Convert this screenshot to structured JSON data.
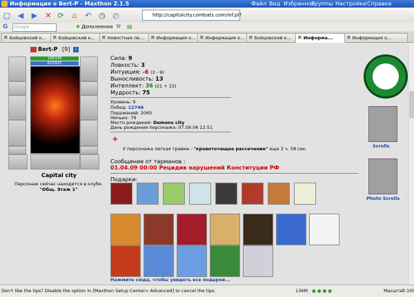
{
  "window": {
    "title": "Информация о Bert-P - Maxthon 2.1.5",
    "menu": [
      "Файл",
      "Вид",
      "Избранное",
      "Группы",
      "Настройки",
      "Справка"
    ]
  },
  "toolbar": {
    "address": "http://capitalcity.combats.com/inf.pl?login=Bert-P",
    "search_placeholder": "Google",
    "addons_label": "Дополнения"
  },
  "tabs": [
    {
      "label": "Бойцовский к..."
    },
    {
      "label": "Бойцовский к..."
    },
    {
      "label": "Новостная ле..."
    },
    {
      "label": "Информация о..."
    },
    {
      "label": "Информация о..."
    },
    {
      "label": "Бойцовский к..."
    },
    {
      "label": "Информа..."
    },
    {
      "label": "Информация о..."
    }
  ],
  "character": {
    "nick": "Bert-P",
    "level_badge": "[9]",
    "hp": "198/198",
    "mp": "625/625",
    "city": "Capital city",
    "location_text": "Персонаж сейчас находится в клубе.",
    "floor": "\"Общ. Этаж 1\""
  },
  "stats": {
    "strength_label": "Сила:",
    "strength": "9",
    "agility_label": "Ловкость:",
    "agility": "3",
    "intuition_label": "Интуиция:",
    "intuition": "-6",
    "intuition_extra": "(3 - 9)",
    "endurance_label": "Выносливость:",
    "endurance": "13",
    "intellect_label": "Интеллект:",
    "intellect": "36",
    "intellect_extra": "(21 + 15)",
    "wisdom_label": "Мудрость:",
    "wisdom": "75"
  },
  "info": {
    "level_label": "Уровень:",
    "level": "9",
    "wins_label": "Побед:",
    "wins": "12746",
    "losses_label": "Поражений:",
    "losses": "2065",
    "draws_label": "Ничьих:",
    "draws": "79",
    "birthplace_label": "Место рождения:",
    "birthplace": "Demons city",
    "birthday_label": "День рождения персонажа:",
    "birthday": "07.09.06 12:51"
  },
  "trauma": {
    "prefix": "У персонажа легкая травма -",
    "name": "\"кровоточащее рассечение\"",
    "suffix": "еще 3 ч. 58 сек."
  },
  "message": {
    "header": "Сообщение от тарманов :",
    "text": "01.04.09 00:00 Рецидив нарушений Конституции РФ"
  },
  "gifts": {
    "header": "Подарки:",
    "link": "Нажмите сюда, чтобы увидеть все подарки..."
  },
  "emblems": {
    "scrolls": "Scrolls",
    "photo_scrolls": "Photo Scrolls"
  },
  "statusbar": {
    "tip": "Don't like the tips? Disable the option in [Maxthon Setup Center> Advanced] to cancel the tips.",
    "memory": "136M",
    "zoom": "Масштаб:100%"
  }
}
